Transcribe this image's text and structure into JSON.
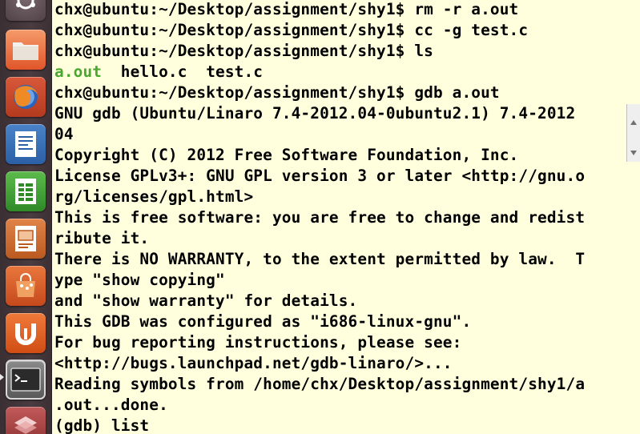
{
  "launcher": {
    "items": [
      {
        "name": "ubuntu-dash-icon"
      },
      {
        "name": "files-folder-icon"
      },
      {
        "name": "firefox-icon"
      },
      {
        "name": "libreoffice-writer-icon"
      },
      {
        "name": "libreoffice-calc-icon"
      },
      {
        "name": "libreoffice-impress-icon"
      },
      {
        "name": "ubuntu-software-center-icon"
      },
      {
        "name": "ubuntu-one-icon"
      },
      {
        "name": "terminal-icon"
      },
      {
        "name": "workspace-switcher-icon"
      }
    ]
  },
  "terminal": {
    "lines": [
      "chx@ubuntu:~/Desktop/assignment/shy1$ rm -r a.out",
      "chx@ubuntu:~/Desktop/assignment/shy1$ cc -g test.c",
      "chx@ubuntu:~/Desktop/assignment/shy1$ ls",
      "",
      "chx@ubuntu:~/Desktop/assignment/shy1$ gdb a.out",
      "GNU gdb (Ubuntu/Linaro 7.4-2012.04-0ubuntu2.1) 7.4-2012",
      "04",
      "Copyright (C) 2012 Free Software Foundation, Inc.",
      "License GPLv3+: GNU GPL version 3 or later <http://gnu.o",
      "rg/licenses/gpl.html>",
      "This is free software: you are free to change and redist",
      "ribute it.",
      "There is NO WARRANTY, to the extent permitted by law.  T",
      "ype \"show copying\"",
      "and \"show warranty\" for details.",
      "This GDB was configured as \"i686-linux-gnu\".",
      "For bug reporting instructions, please see:",
      "<http://bugs.launchpad.net/gdb-linaro/>...",
      "Reading symbols from /home/chx/Desktop/assignment/shy1/a",
      ".out...done.",
      "(gdb) list"
    ],
    "ls_output": {
      "executable": "a.out",
      "files": "  hello.c  test.c"
    }
  },
  "colors": {
    "background": "#ffffdd",
    "text": "#000000",
    "executable": "#4ba82e"
  }
}
